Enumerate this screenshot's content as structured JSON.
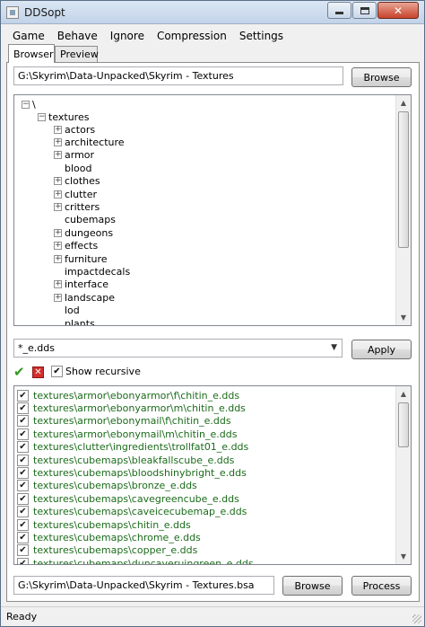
{
  "window": {
    "title": "DDSopt"
  },
  "menu": [
    "Game",
    "Behave",
    "Ignore",
    "Compression",
    "Settings"
  ],
  "tabs": [
    "Browser",
    "Preview"
  ],
  "browser": {
    "path": "G:\\Skyrim\\Data-Unpacked\\Skyrim - Textures",
    "browse_label": "Browse"
  },
  "tree": {
    "root": "\\",
    "folder": "textures",
    "children": [
      {
        "label": "actors",
        "expandable": true
      },
      {
        "label": "architecture",
        "expandable": true
      },
      {
        "label": "armor",
        "expandable": true
      },
      {
        "label": "blood",
        "expandable": false
      },
      {
        "label": "clothes",
        "expandable": true
      },
      {
        "label": "clutter",
        "expandable": true
      },
      {
        "label": "critters",
        "expandable": true
      },
      {
        "label": "cubemaps",
        "expandable": false
      },
      {
        "label": "dungeons",
        "expandable": true
      },
      {
        "label": "effects",
        "expandable": true
      },
      {
        "label": "furniture",
        "expandable": true
      },
      {
        "label": "impactdecals",
        "expandable": false
      },
      {
        "label": "interface",
        "expandable": true
      },
      {
        "label": "landscape",
        "expandable": true
      },
      {
        "label": "lod",
        "expandable": false
      },
      {
        "label": "plants",
        "expandable": false
      }
    ]
  },
  "filter": {
    "value": "*_e.dds",
    "apply_label": "Apply"
  },
  "options": {
    "show_recursive_label": "Show recursive",
    "show_recursive_checked": true
  },
  "files": [
    "textures\\armor\\ebonyarmor\\f\\chitin_e.dds",
    "textures\\armor\\ebonyarmor\\m\\chitin_e.dds",
    "textures\\armor\\ebonymail\\f\\chitin_e.dds",
    "textures\\armor\\ebonymail\\m\\chitin_e.dds",
    "textures\\clutter\\ingredients\\trollfat01_e.dds",
    "textures\\cubemaps\\bleakfallscube_e.dds",
    "textures\\cubemaps\\bloodshinybright_e.dds",
    "textures\\cubemaps\\bronze_e.dds",
    "textures\\cubemaps\\cavegreencube_e.dds",
    "textures\\cubemaps\\caveicecubemap_e.dds",
    "textures\\cubemaps\\chitin_e.dds",
    "textures\\cubemaps\\chrome_e.dds",
    "textures\\cubemaps\\copper_e.dds",
    "textures\\cubemaps\\duncaveruingreen_e.dds"
  ],
  "output": {
    "path": "G:\\Skyrim\\Data-Unpacked\\Skyrim - Textures.bsa",
    "browse_label": "Browse",
    "process_label": "Process"
  },
  "status": "Ready",
  "icons": {
    "check_all": "checkmark-icon",
    "uncheck_all": "red-x-icon"
  },
  "colors": {
    "file_text": "#1b6b1b"
  }
}
